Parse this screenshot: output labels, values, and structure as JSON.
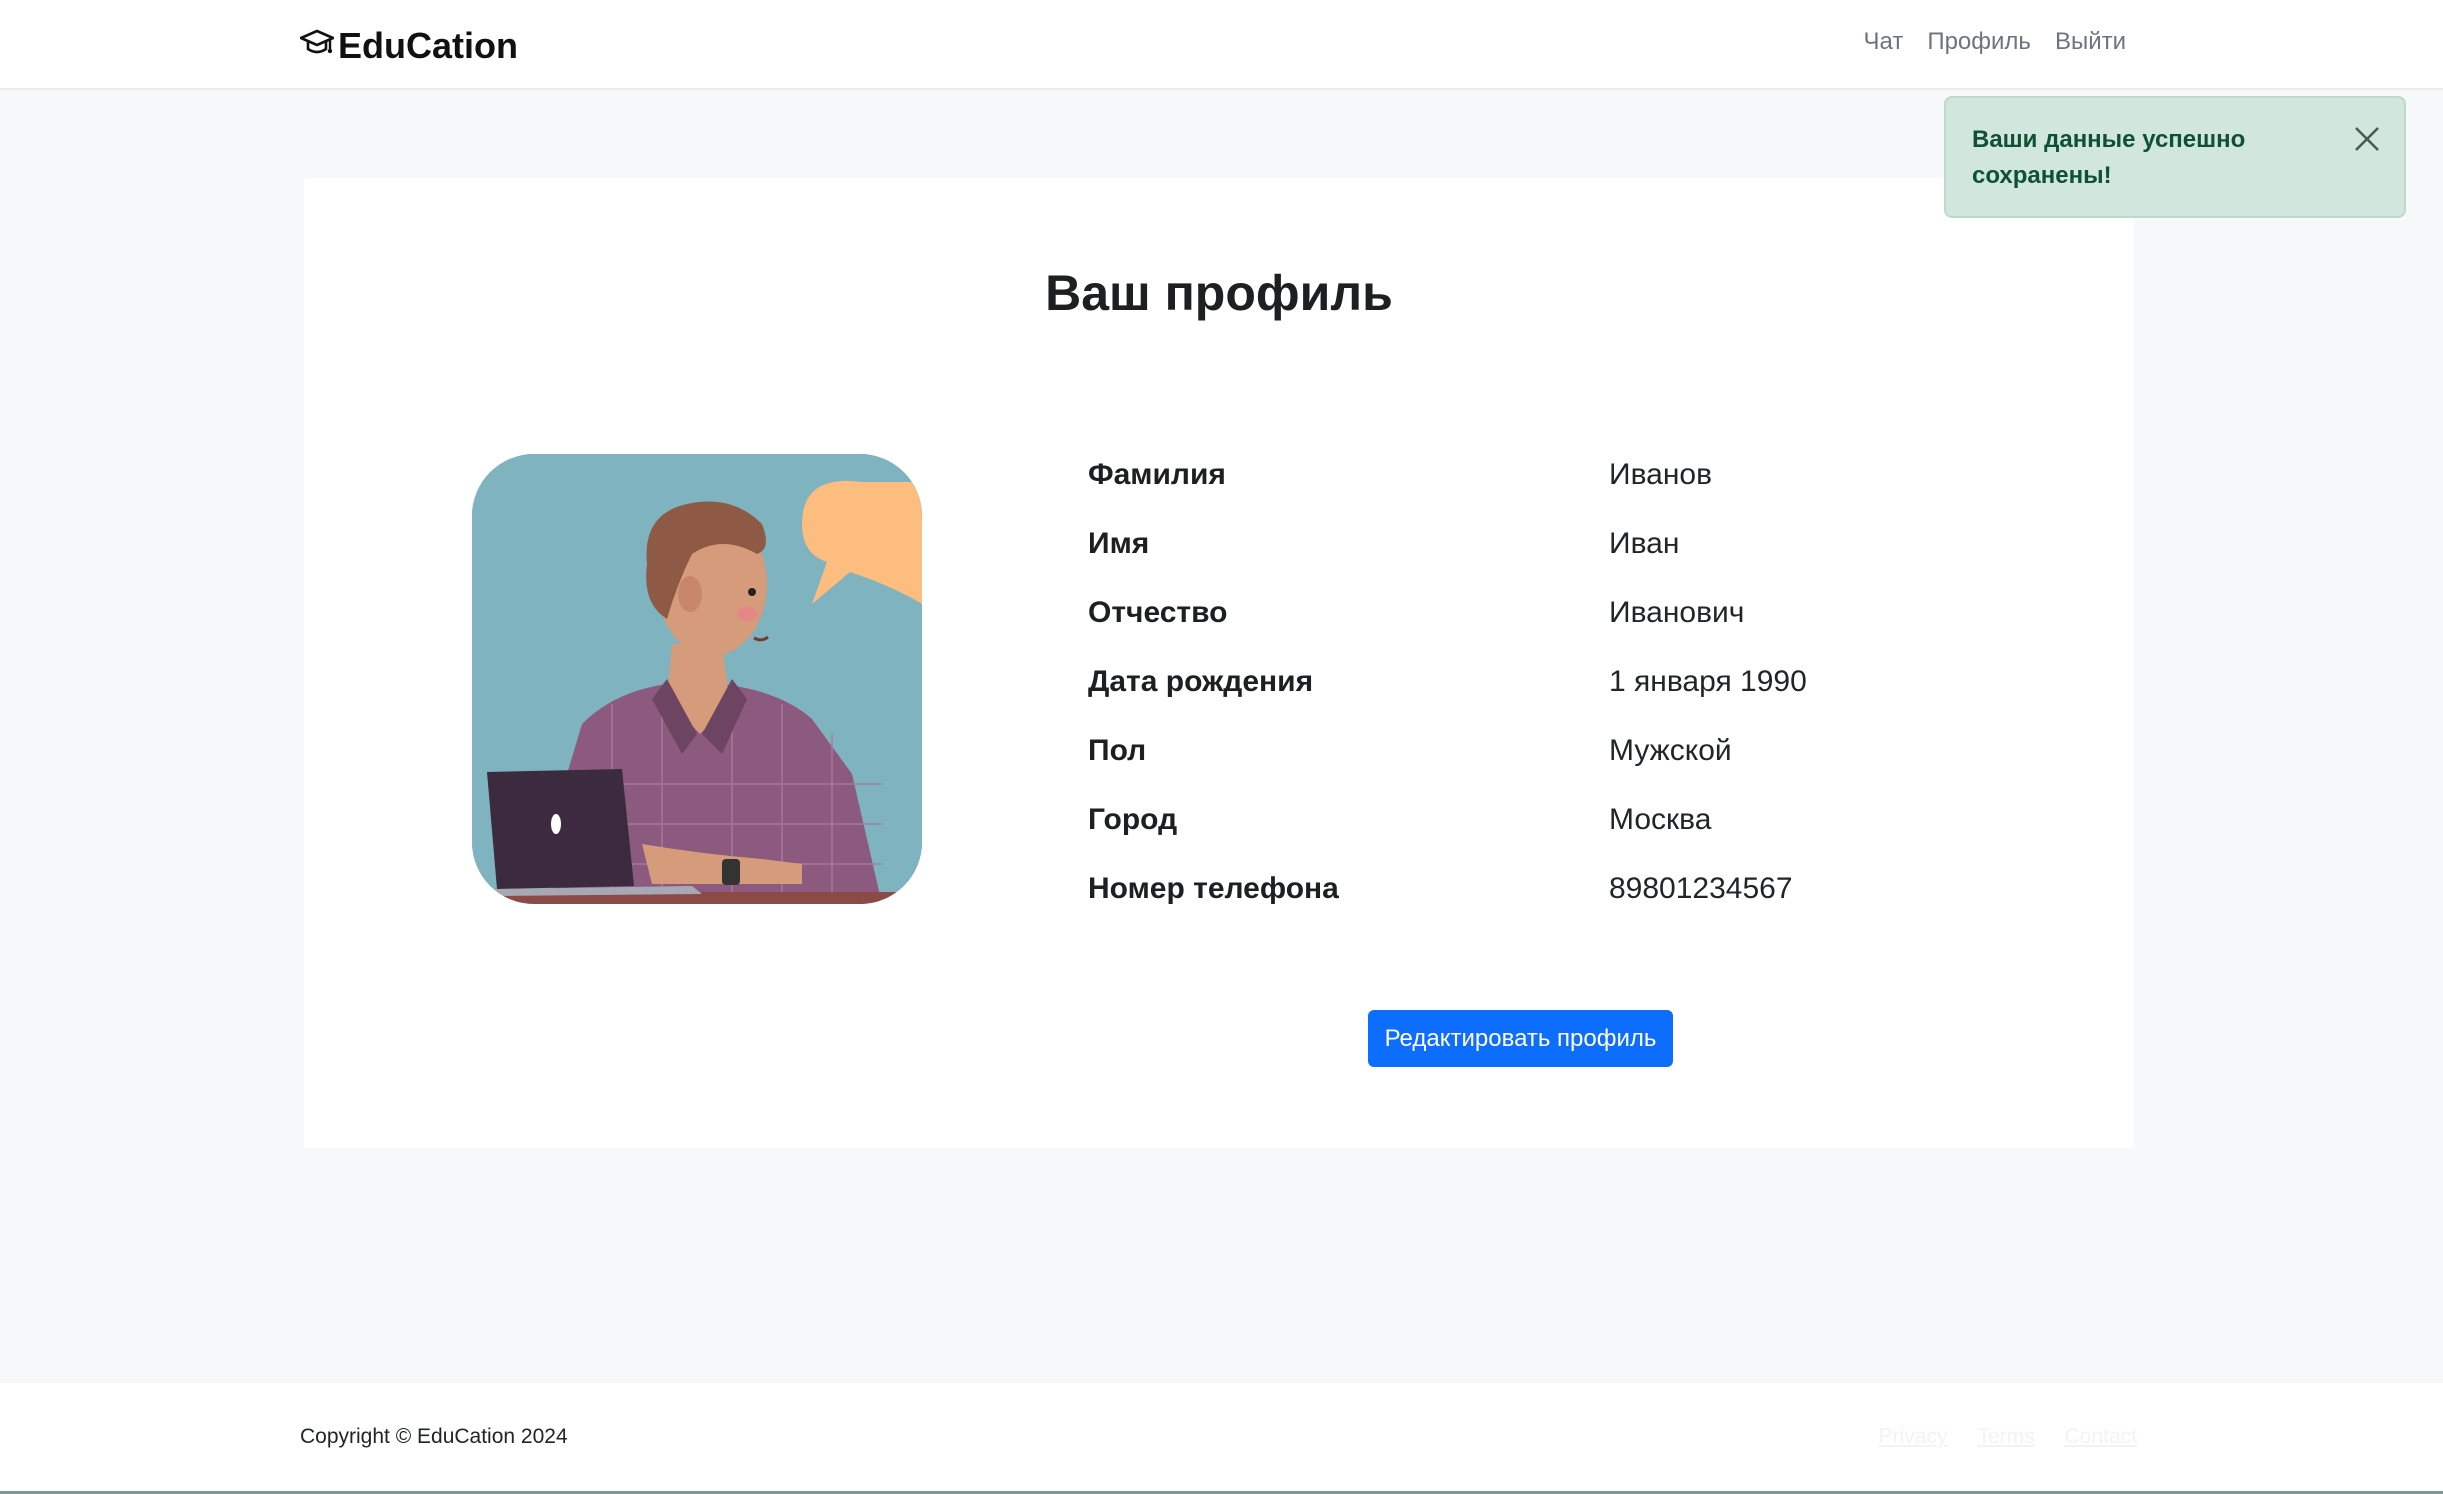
{
  "navbar": {
    "brand": "EduCation",
    "brand_icon": "graduation-cap-icon",
    "links": [
      "Чат",
      "Профиль",
      "Выйти"
    ]
  },
  "toast": {
    "message": "Ваши данные успешно сохранены!",
    "close_icon": "close-icon"
  },
  "profile": {
    "title": "Ваш профиль",
    "avatar": "person-with-laptop-illustration",
    "fields": [
      {
        "label": "Фамилия",
        "value": "Иванов"
      },
      {
        "label": "Имя",
        "value": "Иван"
      },
      {
        "label": "Отчество",
        "value": "Иванович"
      },
      {
        "label": "Дата рождения",
        "value": "1 января 1990"
      },
      {
        "label": "Пол",
        "value": "Мужской"
      },
      {
        "label": "Город",
        "value": "Москва"
      },
      {
        "label": "Номер телефона",
        "value": "89801234567"
      }
    ],
    "edit_button": "Редактировать профиль"
  },
  "footer": {
    "copyright": "Copyright © EduCation 2024",
    "links": [
      "Privacy",
      "Terms",
      "Contact"
    ]
  },
  "colors": {
    "primary": "#0d6efd",
    "toast_bg": "#d1e7dd",
    "toast_text": "#0f5132",
    "page_bg": "#f7f8fa"
  }
}
